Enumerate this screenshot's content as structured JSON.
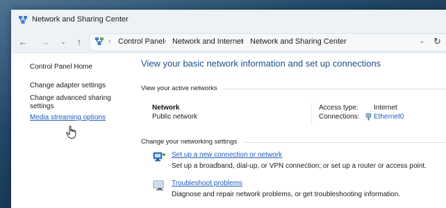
{
  "window": {
    "title": "Network and Sharing Center",
    "title_icon": "network-sharing-icon"
  },
  "navigation": {
    "back_icon": "back-arrow-icon",
    "forward_icon": "forward-arrow-icon",
    "recent_icon": "chevron-down-icon",
    "up_icon": "up-arrow-icon",
    "breadcrumbs": [
      "Control Panel",
      "Network and Internet",
      "Network and Sharing Center"
    ],
    "dropdown_icon": "chevron-down-icon",
    "refresh_icon": "refresh-icon"
  },
  "sidebar": {
    "home": "Control Panel Home",
    "links": [
      {
        "label": "Change adapter settings"
      },
      {
        "label": "Change advanced sharing settings"
      },
      {
        "label": "Media streaming options"
      }
    ]
  },
  "main": {
    "title": "View your basic network information and set up connections",
    "active_networks_label": "View your active networks",
    "network": {
      "name": "Network",
      "type": "Public network",
      "access_type_label": "Access type:",
      "access_type_value": "Internet",
      "connections_label": "Connections:",
      "connections_value": "Ethernet0"
    },
    "change_settings_label": "Change your networking settings",
    "tasks": [
      {
        "link": "Set up a new connection or network",
        "description": "Set up a broadband, dial-up, or VPN connection; or set up a router or access point.",
        "icon": "new-connection-icon"
      },
      {
        "link": "Troubleshoot problems",
        "description": "Diagnose and repair network problems, or get troubleshooting information.",
        "icon": "troubleshoot-icon"
      }
    ]
  },
  "colors": {
    "link": "#1e5bbd",
    "title": "#1e4f86",
    "chrome": "#eef2f6"
  }
}
